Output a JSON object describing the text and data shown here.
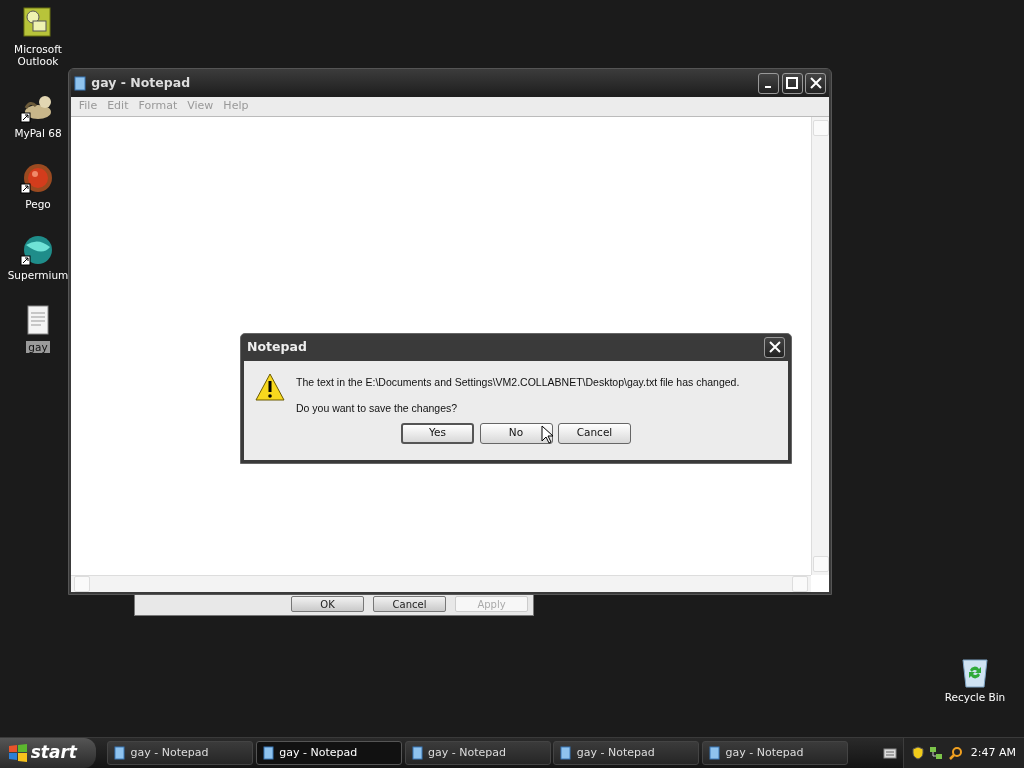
{
  "desktop_icons": [
    {
      "label": "Microsoft Outlook",
      "kind": "outlook",
      "shortcut": false,
      "selected": false
    },
    {
      "label": "MyPal 68",
      "kind": "mypal",
      "shortcut": true,
      "selected": false
    },
    {
      "label": "Pego",
      "kind": "pego",
      "shortcut": true,
      "selected": false
    },
    {
      "label": "Supermium",
      "kind": "supermium",
      "shortcut": true,
      "selected": false
    },
    {
      "label": "gay",
      "kind": "textfile",
      "shortcut": false,
      "selected": true
    }
  ],
  "recycle_bin": {
    "label": "Recycle Bin"
  },
  "background_dialog": {
    "buttons": [
      {
        "label": "OK",
        "disabled": false
      },
      {
        "label": "Cancel",
        "disabled": false
      },
      {
        "label": "Apply",
        "disabled": true
      }
    ]
  },
  "notepad": {
    "title": "gay - Notepad",
    "menu": [
      {
        "label": "File",
        "disabled": true
      },
      {
        "label": "Edit",
        "disabled": true
      },
      {
        "label": "Format",
        "disabled": true
      },
      {
        "label": "View",
        "disabled": true
      },
      {
        "label": "Help",
        "disabled": true
      }
    ]
  },
  "dialog": {
    "title": "Notepad",
    "message": "The text in the E:\\Documents and Settings\\VM2.COLLABNET\\Desktop\\gay.txt file has changed.",
    "question": "Do you want to save the changes?",
    "buttons": [
      {
        "label": "Yes",
        "default": true
      },
      {
        "label": "No",
        "default": false
      },
      {
        "label": "Cancel",
        "default": false
      }
    ]
  },
  "taskbar": {
    "start": "start",
    "buttons": [
      {
        "label": "gay - Notepad",
        "selected": false
      },
      {
        "label": "gay - Notepad",
        "selected": true
      },
      {
        "label": "gay - Notepad",
        "selected": false
      },
      {
        "label": "gay - Notepad",
        "selected": false
      },
      {
        "label": "gay - Notepad",
        "selected": false
      }
    ],
    "clock": "2:47 AM"
  }
}
